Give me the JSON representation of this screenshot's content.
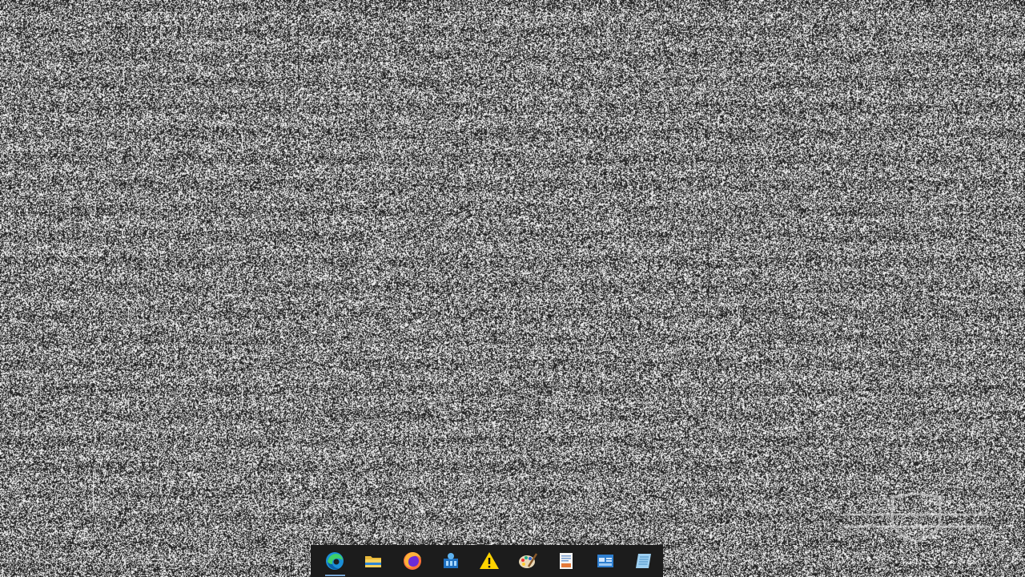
{
  "desktop": {
    "wallpaper": "random-noise",
    "watermark_icon": "shield-watermark-icon"
  },
  "taskbar": {
    "background": "#1c1c1c",
    "apps": [
      {
        "name": "edge",
        "icon": "edge-icon",
        "running": true
      },
      {
        "name": "file-explorer",
        "icon": "folder-icon",
        "running": false
      },
      {
        "name": "firefox",
        "icon": "firefox-icon",
        "running": false
      },
      {
        "name": "app-4",
        "icon": "blue-app-icon",
        "running": false
      },
      {
        "name": "warning-app",
        "icon": "warning-icon",
        "running": false
      },
      {
        "name": "paint-app",
        "icon": "palette-icon",
        "running": false
      },
      {
        "name": "document-app",
        "icon": "document-icon",
        "running": false
      },
      {
        "name": "window-app",
        "icon": "window-icon",
        "running": false
      },
      {
        "name": "notepad-app",
        "icon": "notepad-icon",
        "running": false
      }
    ]
  }
}
